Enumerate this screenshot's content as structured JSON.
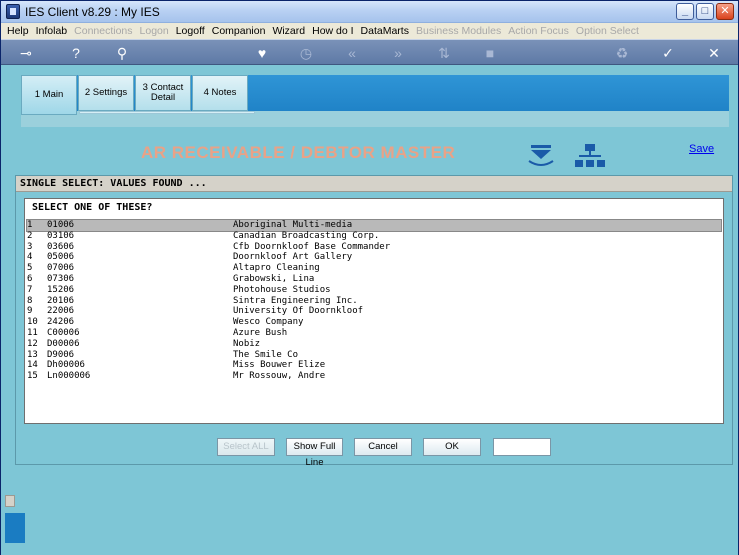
{
  "window": {
    "title": "IES Client v8.29 : My IES"
  },
  "menu": [
    {
      "label": "Help",
      "enabled": true
    },
    {
      "label": "Infolab",
      "enabled": true
    },
    {
      "label": "Connections",
      "enabled": false
    },
    {
      "label": "Logon",
      "enabled": false
    },
    {
      "label": "Logoff",
      "enabled": true
    },
    {
      "label": "Companion",
      "enabled": true
    },
    {
      "label": "Wizard",
      "enabled": true
    },
    {
      "label": "How do I",
      "enabled": true
    },
    {
      "label": "DataMarts",
      "enabled": true
    },
    {
      "label": "Business Modules",
      "enabled": false
    },
    {
      "label": "Action Focus",
      "enabled": false
    },
    {
      "label": "Option Select",
      "enabled": false
    }
  ],
  "toolbar": {
    "icons": [
      "key-icon",
      "help-icon",
      "search-icon",
      "heart-icon",
      "clock-icon",
      "rewind-icon",
      "fast-forward-icon",
      "sort-icon",
      "stop-icon",
      "recycle-icon",
      "check-icon",
      "close-icon"
    ]
  },
  "tabs": [
    {
      "label": "1 Main",
      "active": true
    },
    {
      "label": "2 Settings",
      "active": false
    },
    {
      "label": "3 Contact Detail",
      "active": false
    },
    {
      "label": "4 Notes",
      "active": false
    }
  ],
  "page": {
    "module_title": "AR RECEIVABLE / DEBTOR MASTER",
    "save_label": "Save"
  },
  "dialog": {
    "header": "SINGLE SELECT: VALUES FOUND ...",
    "prompt": "SELECT ONE OF THESE?",
    "rows": [
      {
        "num": "1",
        "code": "01006",
        "name": "Aboriginal Multi-media",
        "selected": true
      },
      {
        "num": "2",
        "code": "03106",
        "name": "Canadian Broadcasting Corp.",
        "selected": false
      },
      {
        "num": "3",
        "code": "03606",
        "name": "Cfb Doornkloof Base Commander",
        "selected": false
      },
      {
        "num": "4",
        "code": "05006",
        "name": "Doornkloof Art Gallery",
        "selected": false
      },
      {
        "num": "5",
        "code": "07006",
        "name": "Altapro Cleaning",
        "selected": false
      },
      {
        "num": "6",
        "code": "07306",
        "name": "Grabowski, Lina",
        "selected": false
      },
      {
        "num": "7",
        "code": "15206",
        "name": "Photohouse Studios",
        "selected": false
      },
      {
        "num": "8",
        "code": "20106",
        "name": "Sintra Engineering Inc.",
        "selected": false
      },
      {
        "num": "9",
        "code": "22006",
        "name": "University Of Doornkloof",
        "selected": false
      },
      {
        "num": "10",
        "code": "24206",
        "name": "Wesco Company",
        "selected": false
      },
      {
        "num": "11",
        "code": "C00006",
        "name": "Azure Bush",
        "selected": false
      },
      {
        "num": "12",
        "code": "D00006",
        "name": "Nobiz",
        "selected": false
      },
      {
        "num": "13",
        "code": "D9006",
        "name": "The Smile Co",
        "selected": false
      },
      {
        "num": "14",
        "code": "Dh00006",
        "name": "Miss Bouwer Elize",
        "selected": false
      },
      {
        "num": "15",
        "code": "Ln000006",
        "name": "Mr Rossouw, Andre",
        "selected": false
      }
    ],
    "buttons": {
      "select_all": "Select ALL",
      "show_full_line": "Show Full Line",
      "cancel": "Cancel",
      "ok": "OK"
    },
    "input_value": ""
  },
  "colors": {
    "accent_blue": "#1a7cc2",
    "background_teal": "#7ec6d6",
    "module_title": "#e9a287",
    "link": "#0000ee"
  }
}
